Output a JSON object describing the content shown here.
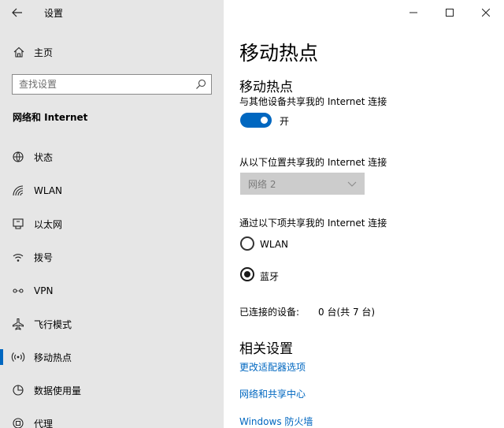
{
  "window": {
    "title": "设置",
    "controls": [
      "minimize",
      "maximize",
      "close"
    ]
  },
  "sidebar": {
    "home_label": "主页",
    "search_placeholder": "查找设置",
    "section_label": "网络和 Internet",
    "items": [
      {
        "label": "状态",
        "icon": "globe-icon"
      },
      {
        "label": "WLAN",
        "icon": "wifi-icon"
      },
      {
        "label": "以太网",
        "icon": "ethernet-icon"
      },
      {
        "label": "拨号",
        "icon": "dialup-icon"
      },
      {
        "label": "VPN",
        "icon": "vpn-icon"
      },
      {
        "label": "飞行模式",
        "icon": "airplane-icon"
      },
      {
        "label": "移动热点",
        "icon": "hotspot-icon",
        "active": true
      },
      {
        "label": "数据使用量",
        "icon": "data-usage-icon"
      },
      {
        "label": "代理",
        "icon": "proxy-icon"
      }
    ]
  },
  "main": {
    "page_title": "移动热点",
    "hotspot_heading": "移动热点",
    "share_label": "与其他设备共享我的 Internet 连接",
    "toggle_state": "开",
    "share_from_label": "从以下位置共享我的 Internet 连接",
    "share_from_value": "网络 2",
    "share_over_label": "通过以下项共享我的 Internet 连接",
    "options": [
      {
        "label": "WLAN",
        "selected": false
      },
      {
        "label": "蓝牙",
        "selected": true
      }
    ],
    "connected_label": "已连接的设备:",
    "connected_value": "0 台(共 7 台)",
    "related_heading": "相关设置",
    "links": [
      "更改适配器选项",
      "网络和共享中心",
      "Windows 防火墙"
    ]
  },
  "colors": {
    "accent": "#0067c0",
    "sidebar_bg": "#e6e6e6"
  }
}
